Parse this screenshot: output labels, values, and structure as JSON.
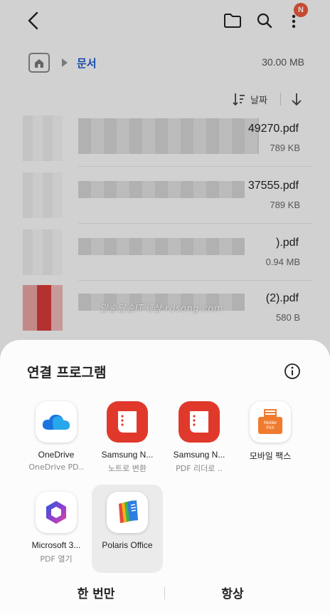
{
  "appbar": {
    "badge": "N"
  },
  "breadcrumb": {
    "folder": "문서",
    "size": "30.00 MB"
  },
  "sort": {
    "label": "날짜"
  },
  "files": [
    {
      "name": "49270.pdf",
      "size": "789 KB"
    },
    {
      "name": "37555.pdf",
      "size": "789 KB"
    },
    {
      "name": ").pdf",
      "size": "0.94 MB"
    },
    {
      "name": "(2).pdf",
      "size": "580 B"
    }
  ],
  "watermark": "알송달송IT세상 rdsong.com",
  "sheet": {
    "title": "연결 프로그램",
    "apps": [
      {
        "name": "OneDrive",
        "sub": "OneDrive PD.."
      },
      {
        "name": "Samsung N...",
        "sub": "노트로 변환"
      },
      {
        "name": "Samsung N...",
        "sub": "PDF 리더로 .."
      },
      {
        "name": "모바일 팩스",
        "sub": ""
      },
      {
        "name": "Microsoft 3...",
        "sub": "PDF 열기"
      },
      {
        "name": "Polaris Office",
        "sub": ""
      }
    ],
    "fax_icon_text": "Mobile FAX",
    "buttons": {
      "once": "한 번만",
      "always": "항상"
    }
  },
  "colors": {
    "accent": "#1a56c4",
    "badge": "#e8583a",
    "samsung_notes": "#e0392b",
    "fax": "#f07b2e"
  }
}
